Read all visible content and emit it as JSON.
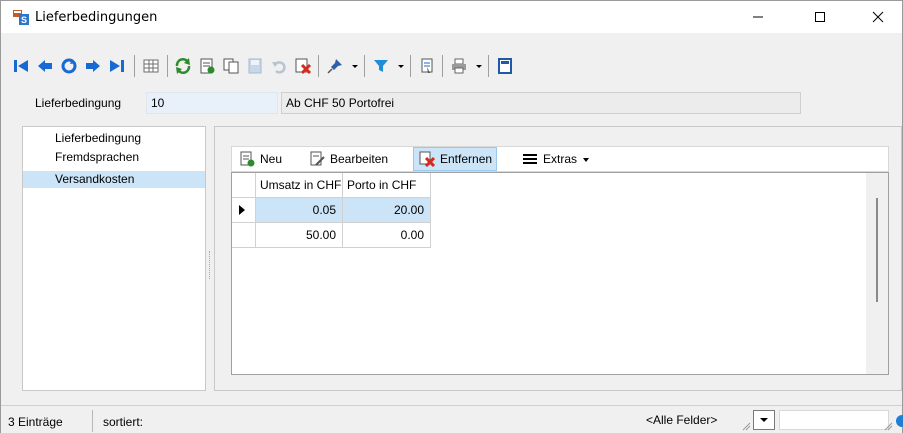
{
  "window": {
    "title": "Lieferbedingungen",
    "icon": "app-form-icon",
    "controls": [
      "minimize",
      "maximize",
      "close"
    ]
  },
  "toolbar": {
    "icons": [
      "first-record-icon",
      "previous-record-icon",
      "refresh-record-icon",
      "next-record-icon",
      "last-record-icon",
      "table-view-icon",
      "reload-icon",
      "new-record-icon",
      "copy-record-icon",
      "save-icon",
      "undo-icon",
      "delete-record-icon",
      "pin-icon",
      "filter-icon",
      "print-preview-icon",
      "print-icon",
      "layout-icon"
    ],
    "colors": {
      "nav_blue": "#1769d4",
      "green": "#2d8a2d",
      "red": "#d52b1e"
    }
  },
  "header": {
    "label": "Lieferbedingung",
    "number": "10",
    "description": "Ab CHF 50 Portofrei"
  },
  "nav": {
    "items": [
      {
        "label": "Lieferbedingung",
        "selected": false
      },
      {
        "label": "Fremdsprachen",
        "selected": false
      },
      {
        "label": "Versandkosten",
        "selected": true
      }
    ]
  },
  "grid_toolbar": {
    "new_label": "Neu",
    "edit_label": "Bearbeiten",
    "delete_label": "Entfernen",
    "extras_label": "Extras"
  },
  "grid": {
    "columns": [
      "Umsatz in CHF",
      "Porto in CHF"
    ],
    "rows": [
      {
        "umsatz": "0.05",
        "porto": "20.00",
        "selected": true
      },
      {
        "umsatz": "50.00",
        "porto": "0.00",
        "selected": false
      }
    ]
  },
  "status": {
    "count": "3 Einträge",
    "sort": "sortiert:",
    "field_select": "<Alle Felder>",
    "search_value": ""
  },
  "colors": {
    "selection": "#cce4f7",
    "field_bg": "#e8f0fa",
    "window_bg": "#f0f0f0"
  }
}
